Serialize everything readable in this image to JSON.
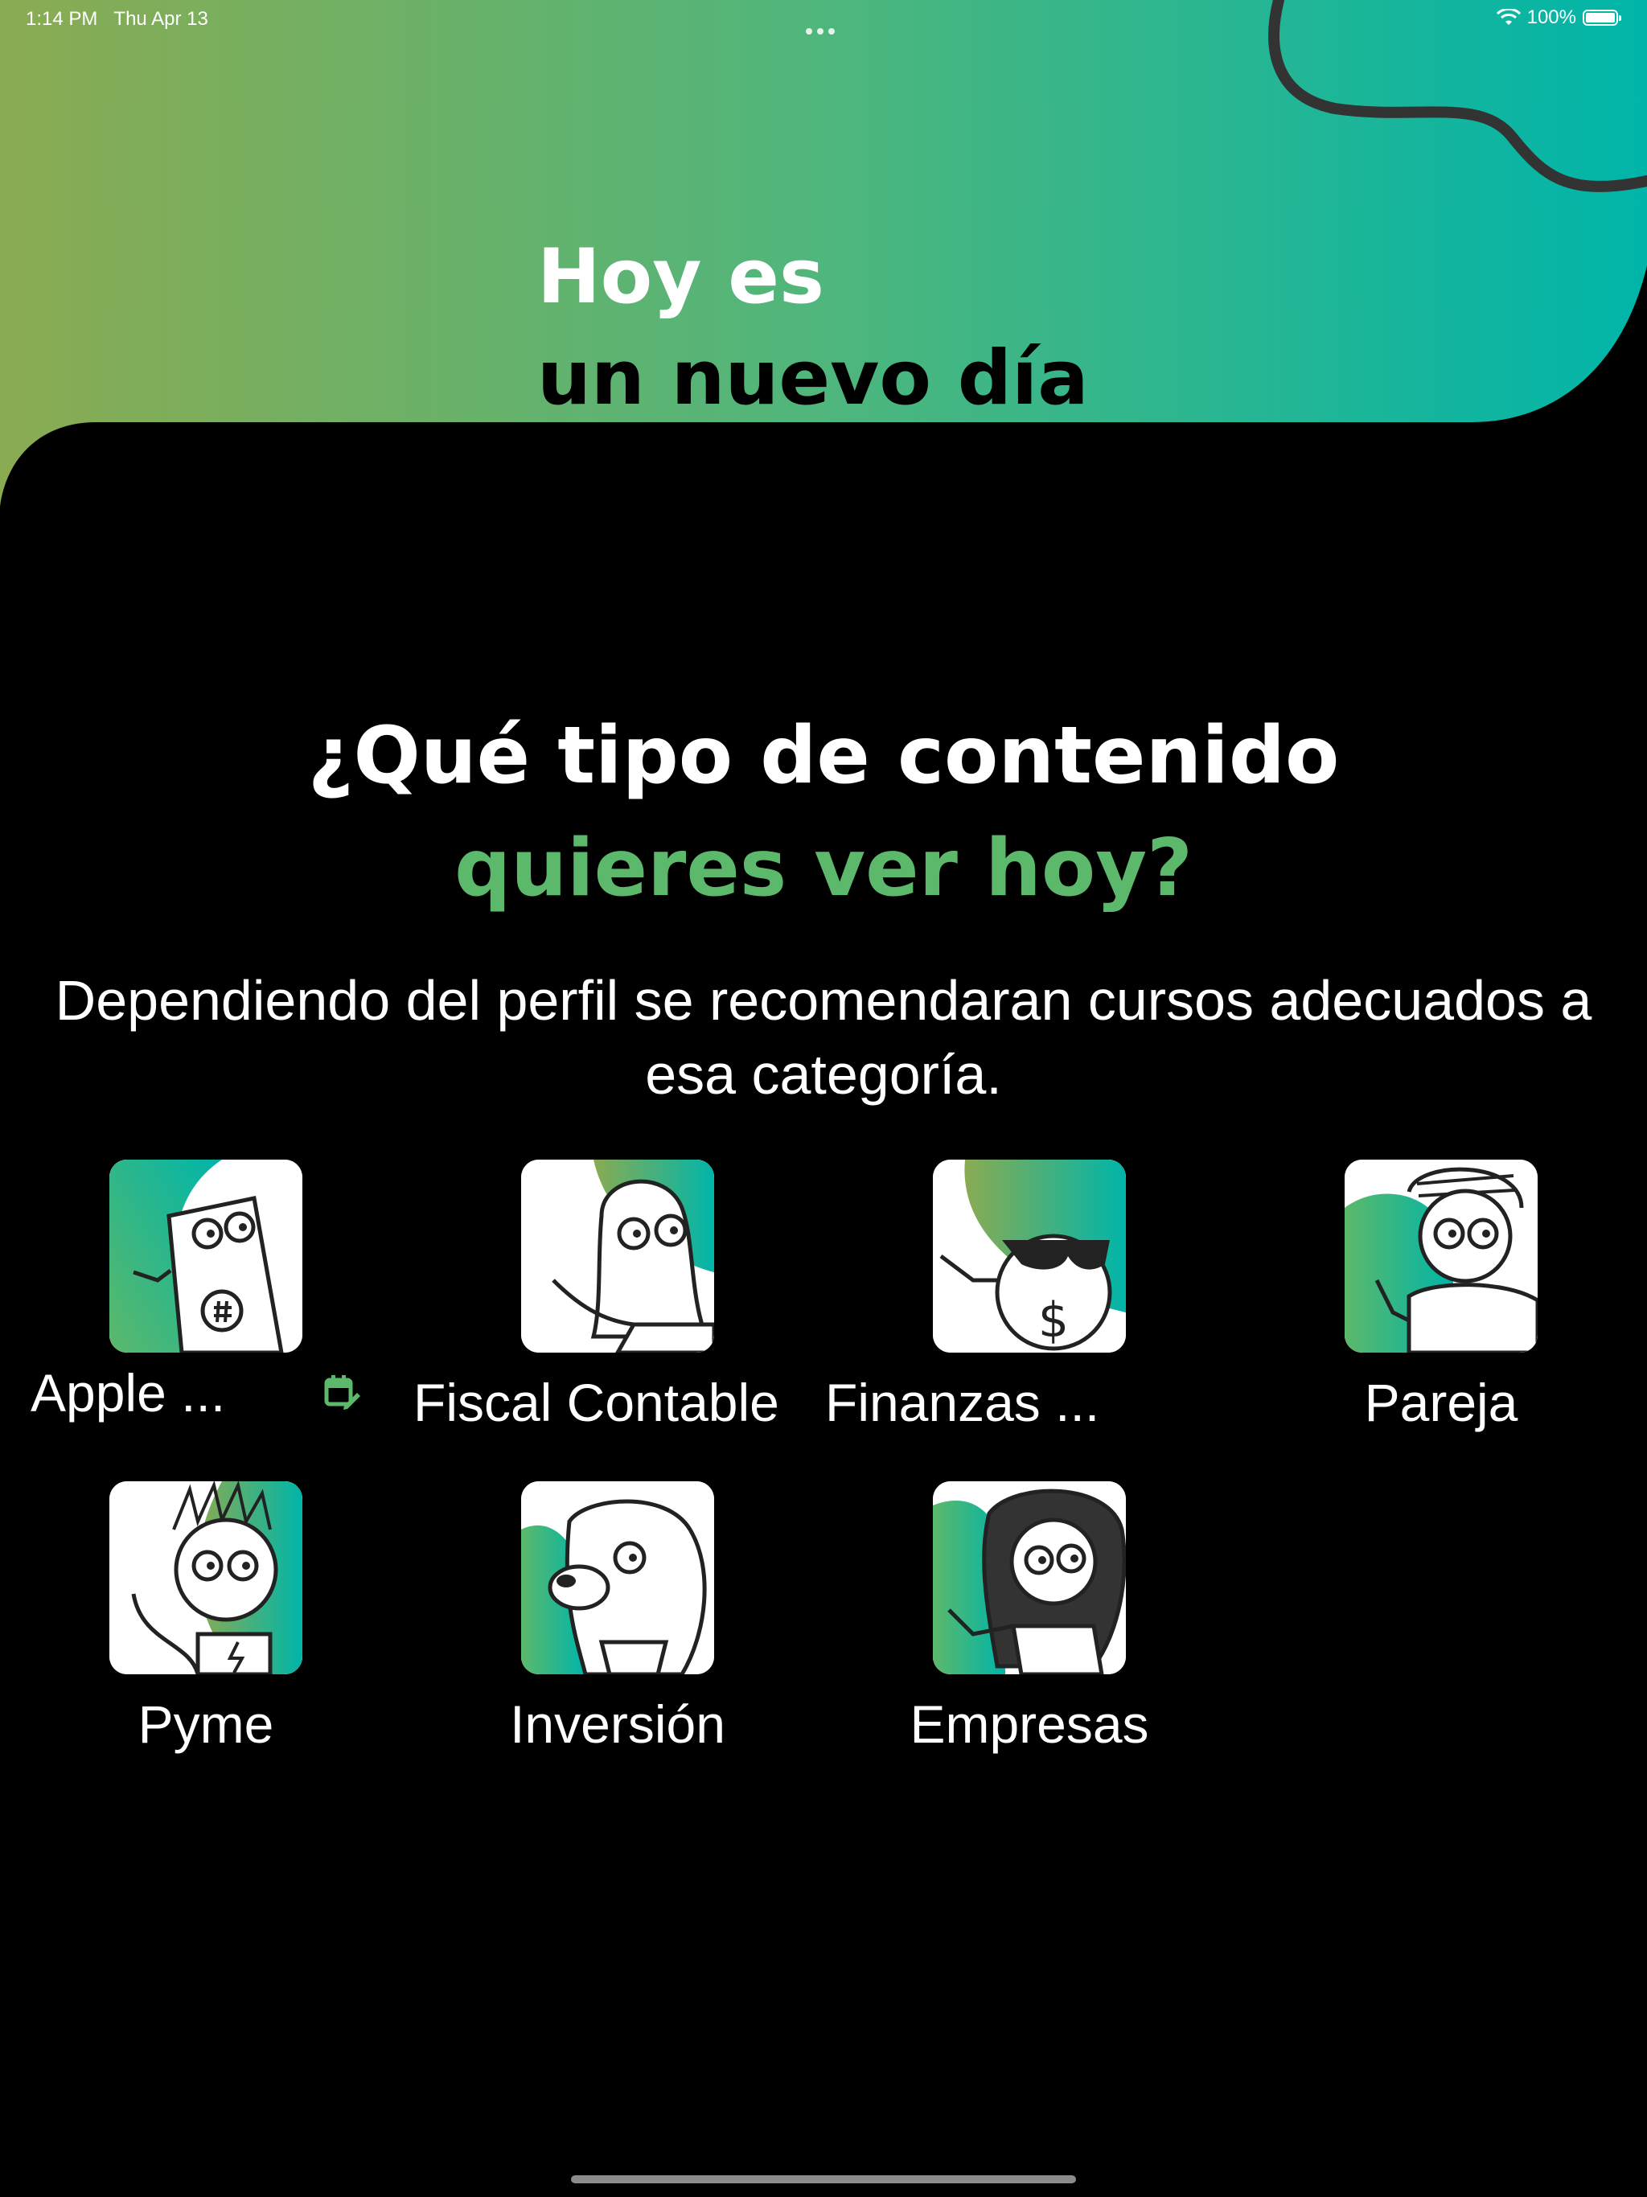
{
  "status_bar": {
    "time": "1:14 PM",
    "date": "Thu Apr 13",
    "battery_label": "100%",
    "wifi_icon": "wifi-icon",
    "battery_icon": "battery-icon"
  },
  "hero": {
    "line1": "Hoy es",
    "line2": "un nuevo día"
  },
  "question": {
    "line1": "¿Qué tipo de contenido",
    "line2": "quieres ver hoy?"
  },
  "subtitle": "Dependiendo del perfil se recomendaran cursos adecuados a esa categoría.",
  "categories": [
    {
      "label": "Apple ..."
    },
    {
      "label": "Fiscal Contable"
    },
    {
      "label": "Finanzas ..."
    },
    {
      "label": "Pareja"
    },
    {
      "label": "Pyme"
    },
    {
      "label": "Inversión"
    },
    {
      "label": "Empresas"
    }
  ],
  "colors": {
    "accent_green": "#5cb86a",
    "gradient_start": "#8aab52",
    "gradient_mid": "#4fb67c",
    "gradient_end": "#00b5a9"
  }
}
